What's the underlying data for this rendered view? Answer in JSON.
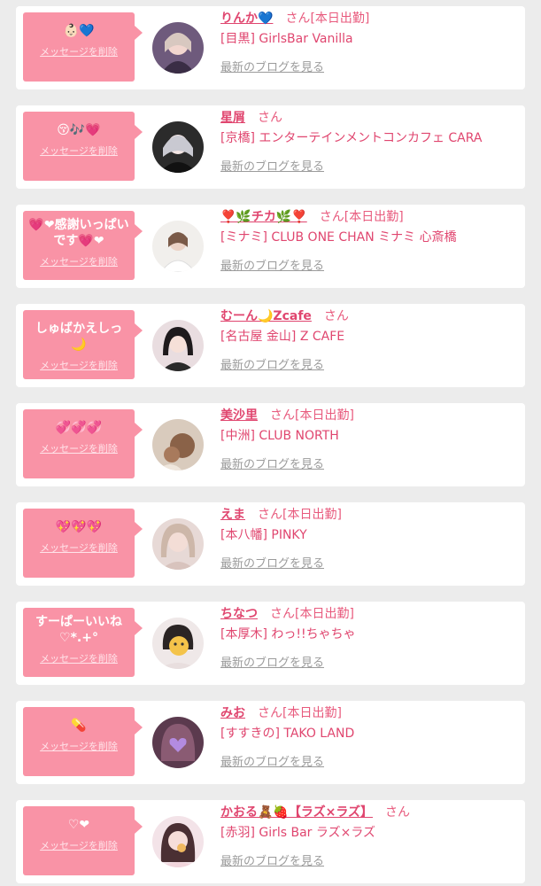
{
  "colors": {
    "page_bg": "#ececec",
    "card_bg": "#ffffff",
    "bubble_bg": "#f993a6",
    "name_pink": "#e0466f",
    "link_gray": "#9b9b9b"
  },
  "labels": {
    "delete": "メッセージを削除",
    "blog": "最新のブログを見る",
    "san": "さん"
  },
  "entries": [
    {
      "message": "👶🏻💙",
      "name": "りんか💙",
      "status": "[本日出勤]",
      "shop": "[目黒] GirlsBar Vanilla",
      "avatar_icon": "avatar-photo-icon"
    },
    {
      "message": "😚🎶💗",
      "name": "星屑",
      "status": "",
      "shop": "[京橋] エンターテインメントコンカフェ CARA",
      "avatar_icon": "avatar-photo-icon"
    },
    {
      "message": "💗❤感謝いっぱいです💗❤",
      "name": "❣️🌿チカ🌿❣️",
      "status": "[本日出勤]",
      "shop": "[ミナミ] CLUB ONE CHAN ミナミ 心斎橋",
      "avatar_icon": "avatar-photo-icon"
    },
    {
      "message": "しゅばかえしっ🌙",
      "name": "むーん🌙Zcafe",
      "status": "",
      "shop": "[名古屋 金山] Z CAFE",
      "avatar_icon": "avatar-photo-icon"
    },
    {
      "message": "💞💞💞",
      "name": "美沙里",
      "status": "[本日出勤]",
      "shop": "[中洲] CLUB NORTH",
      "avatar_icon": "avatar-photo-icon"
    },
    {
      "message": "💖💖💖",
      "name": "えま",
      "status": "[本日出勤]",
      "shop": "[本八幡] PINKY",
      "avatar_icon": "avatar-photo-icon"
    },
    {
      "message": "すーぱーいいね ♡*.+°",
      "name": "ちなつ",
      "status": "[本日出勤]",
      "shop": "[本厚木] わっ!!ちゃちゃ",
      "avatar_icon": "avatar-photo-icon"
    },
    {
      "message": "💊",
      "name": "みお",
      "status": "[本日出勤]",
      "shop": "[すすきの] TAKO LAND",
      "avatar_icon": "avatar-photo-icon"
    },
    {
      "message": "♡❤︎",
      "name": "かおる🧸🍓【ラズ×ラズ】",
      "status": "",
      "shop": "[赤羽] Girls Bar ラズ×ラズ",
      "avatar_icon": "avatar-photo-icon"
    }
  ]
}
